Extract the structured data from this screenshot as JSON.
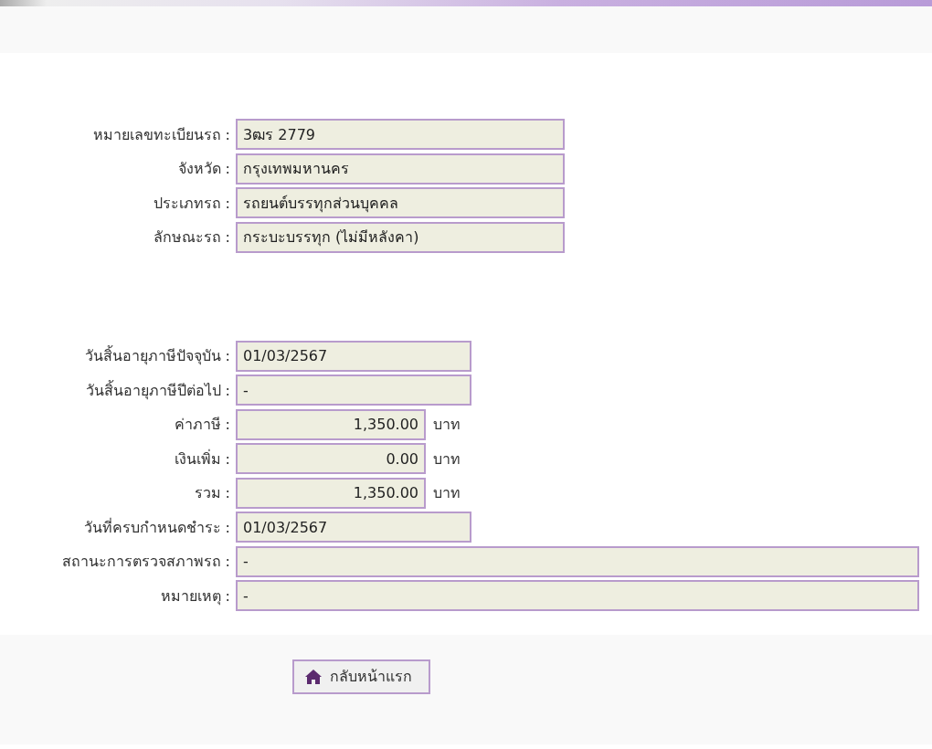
{
  "vehicle": [
    {
      "kind": "text",
      "label": "หมายเลขทะเบียนรถ :",
      "value": "3ฒร 2779"
    },
    {
      "kind": "text",
      "label": "จังหวัด :",
      "value": "กรุงเทพมหานคร"
    },
    {
      "kind": "text",
      "label": "ประเภทรถ :",
      "value": "รถยนต์บรรทุกส่วนบุคคล"
    },
    {
      "kind": "text",
      "label": "ลักษณะรถ :",
      "value": "กระบะบรรทุก (ไม่มีหลังคา)"
    }
  ],
  "tax": [
    {
      "kind": "date",
      "label": "วันสิ้นอายุภาษีปัจจุบัน :",
      "value": "01/03/2567"
    },
    {
      "kind": "date",
      "label": "วันสิ้นอายุภาษีปีต่อไป :",
      "value": "-"
    },
    {
      "kind": "amount",
      "label": "ค่าภาษี :",
      "value": "1,350.00",
      "unit": "บาท"
    },
    {
      "kind": "amount",
      "label": "เงินเพิ่ม :",
      "value": "0.00",
      "unit": "บาท"
    },
    {
      "kind": "amount",
      "label": "รวม :",
      "value": "1,350.00",
      "unit": "บาท"
    },
    {
      "kind": "date",
      "label": "วันที่ครบกำหนดชำระ :",
      "value": "01/03/2567"
    },
    {
      "kind": "note",
      "label": "สถานะการตรวจสภาพรถ :",
      "value": "-"
    },
    {
      "kind": "note",
      "label": "หมายเหตุ :",
      "value": "-"
    }
  ],
  "home_button": {
    "label": "กลับหน้าแรก"
  }
}
